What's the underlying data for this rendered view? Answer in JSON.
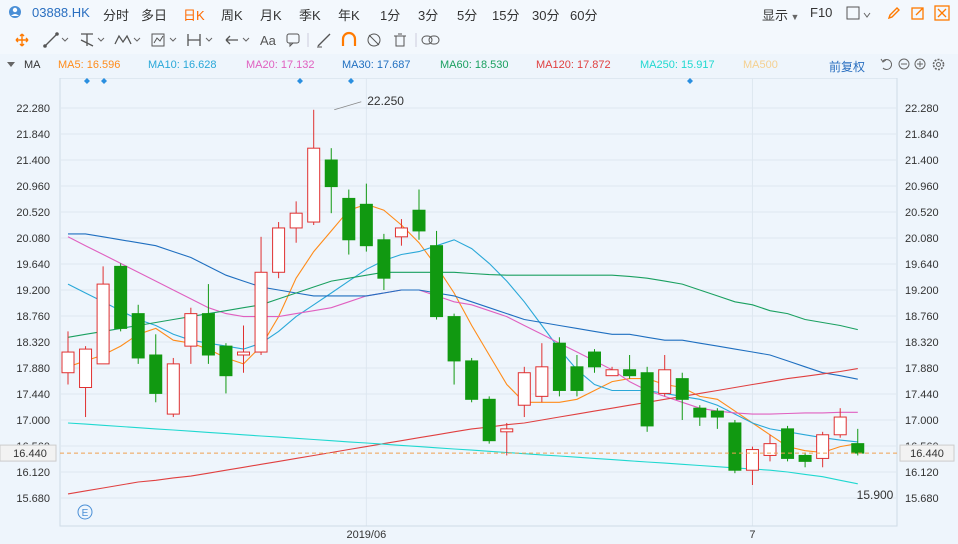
{
  "toolbar": {
    "stock_code": "03888.HK",
    "periods": [
      "分时",
      "多日",
      "日K",
      "周K",
      "月K",
      "季K",
      "年K",
      "1分",
      "3分",
      "5分",
      "15分",
      "30分",
      "60分"
    ],
    "active_period": "日K",
    "display_label": "显示",
    "f10_label": "F10"
  },
  "tools": {
    "text_tool": "Aa",
    "icons": [
      "move-icon",
      "line-icon",
      "channel-icon",
      "wave-icon",
      "measure-icon",
      "range-icon",
      "arrow-icon",
      "text-icon",
      "comment-icon",
      "pen-icon",
      "magnet-icon",
      "hide-icon",
      "trash-icon",
      "link-icon"
    ]
  },
  "indicator_bar": {
    "name": "MA",
    "ma": [
      {
        "label": "MA5: 16.596",
        "color": "#ff8c1a"
      },
      {
        "label": "MA10: 16.628",
        "color": "#2aa8d8"
      },
      {
        "label": "MA20: 17.132",
        "color": "#e060c0"
      },
      {
        "label": "MA30: 17.687",
        "color": "#1f6fc0"
      },
      {
        "label": "MA60: 18.530",
        "color": "#1aa060"
      },
      {
        "label": "MA120: 17.872",
        "color": "#e04040"
      },
      {
        "label": "MA250: 15.917",
        "color": "#20d8d0"
      },
      {
        "label": "MA500",
        "color": "#f5d090"
      }
    ],
    "restore_label": "前复权"
  },
  "colors": {
    "up": "#e03030",
    "down": "#119911",
    "grid": "#dde7f0",
    "axis_text": "#333333"
  },
  "chart_data": {
    "type": "candlestick",
    "y_ticks": [
      22.28,
      21.84,
      21.4,
      20.96,
      20.52,
      20.08,
      19.64,
      19.2,
      18.76,
      18.32,
      17.88,
      17.44,
      17.0,
      16.56,
      16.12,
      15.68
    ],
    "ylim": [
      15.4,
      22.6
    ],
    "x_labels": [
      {
        "index": 17,
        "label": "2019/06"
      },
      {
        "index": 39,
        "label": "7"
      }
    ],
    "current_price": 16.44,
    "annotations": [
      {
        "index": 15,
        "value": 22.25,
        "label": "22.250"
      },
      {
        "index": 43,
        "value": 15.9,
        "label": "15.900"
      }
    ],
    "candles": [
      {
        "o": 17.8,
        "c": 18.15,
        "h": 18.5,
        "l": 17.6
      },
      {
        "o": 17.55,
        "c": 18.2,
        "h": 18.25,
        "l": 17.05
      },
      {
        "o": 17.95,
        "c": 19.3,
        "h": 19.6,
        "l": 17.95
      },
      {
        "o": 19.6,
        "c": 18.55,
        "h": 19.65,
        "l": 18.5
      },
      {
        "o": 18.8,
        "c": 18.05,
        "h": 18.95,
        "l": 17.95
      },
      {
        "o": 18.1,
        "c": 17.45,
        "h": 18.45,
        "l": 17.3
      },
      {
        "o": 17.1,
        "c": 17.95,
        "h": 18.05,
        "l": 17.05
      },
      {
        "o": 18.25,
        "c": 18.8,
        "h": 18.9,
        "l": 17.95
      },
      {
        "o": 18.8,
        "c": 18.1,
        "h": 19.3,
        "l": 17.95
      },
      {
        "o": 18.25,
        "c": 17.75,
        "h": 18.3,
        "l": 17.45
      },
      {
        "o": 18.1,
        "c": 18.15,
        "h": 18.6,
        "l": 17.8
      },
      {
        "o": 18.15,
        "c": 19.5,
        "h": 20.1,
        "l": 18.1
      },
      {
        "o": 19.5,
        "c": 20.25,
        "h": 20.35,
        "l": 19.4
      },
      {
        "o": 20.25,
        "c": 20.5,
        "h": 20.7,
        "l": 20.0
      },
      {
        "o": 20.35,
        "c": 21.6,
        "h": 22.25,
        "l": 20.3
      },
      {
        "o": 21.4,
        "c": 20.95,
        "h": 21.6,
        "l": 20.5
      },
      {
        "o": 20.75,
        "c": 20.05,
        "h": 20.9,
        "l": 19.8
      },
      {
        "o": 20.65,
        "c": 19.95,
        "h": 21.0,
        "l": 19.85
      },
      {
        "o": 20.05,
        "c": 19.4,
        "h": 20.15,
        "l": 19.2
      },
      {
        "o": 20.1,
        "c": 20.25,
        "h": 20.4,
        "l": 19.95
      },
      {
        "o": 20.55,
        "c": 20.2,
        "h": 20.9,
        "l": 20.05
      },
      {
        "o": 19.95,
        "c": 18.75,
        "h": 20.2,
        "l": 18.7
      },
      {
        "o": 18.75,
        "c": 18.0,
        "h": 18.8,
        "l": 17.6
      },
      {
        "o": 18.0,
        "c": 17.35,
        "h": 18.05,
        "l": 17.3
      },
      {
        "o": 17.35,
        "c": 16.65,
        "h": 17.4,
        "l": 16.6
      },
      {
        "o": 16.8,
        "c": 16.85,
        "h": 16.95,
        "l": 16.4
      },
      {
        "o": 17.25,
        "c": 17.8,
        "h": 17.9,
        "l": 17.05
      },
      {
        "o": 17.4,
        "c": 17.9,
        "h": 18.3,
        "l": 17.3
      },
      {
        "o": 18.3,
        "c": 17.5,
        "h": 18.4,
        "l": 17.4
      },
      {
        "o": 17.9,
        "c": 17.5,
        "h": 18.1,
        "l": 17.4
      },
      {
        "o": 18.15,
        "c": 17.9,
        "h": 18.2,
        "l": 17.8
      },
      {
        "o": 17.75,
        "c": 17.85,
        "h": 17.9,
        "l": 17.75
      },
      {
        "o": 17.85,
        "c": 17.75,
        "h": 18.1,
        "l": 17.7
      },
      {
        "o": 17.8,
        "c": 16.9,
        "h": 17.9,
        "l": 16.8
      },
      {
        "o": 17.45,
        "c": 17.85,
        "h": 18.1,
        "l": 17.4
      },
      {
        "o": 17.7,
        "c": 17.35,
        "h": 17.8,
        "l": 17.0
      },
      {
        "o": 17.2,
        "c": 17.05,
        "h": 17.25,
        "l": 16.9
      },
      {
        "o": 17.15,
        "c": 17.05,
        "h": 17.2,
        "l": 16.85
      },
      {
        "o": 16.95,
        "c": 16.15,
        "h": 17.0,
        "l": 16.1
      },
      {
        "o": 16.15,
        "c": 16.5,
        "h": 16.55,
        "l": 15.9
      },
      {
        "o": 16.4,
        "c": 16.6,
        "h": 16.75,
        "l": 16.3
      },
      {
        "o": 16.85,
        "c": 16.35,
        "h": 16.9,
        "l": 16.3
      },
      {
        "o": 16.4,
        "c": 16.3,
        "h": 16.45,
        "l": 16.2
      },
      {
        "o": 16.35,
        "c": 16.75,
        "h": 16.8,
        "l": 16.2
      },
      {
        "o": 16.75,
        "c": 17.05,
        "h": 17.2,
        "l": 16.7
      },
      {
        "o": 16.6,
        "c": 16.44,
        "h": 16.85,
        "l": 16.4
      }
    ],
    "ma_lines": [
      {
        "name": "MA5",
        "color": "#ff8c1a",
        "values": [
          17.9,
          18.0,
          18.1,
          18.25,
          18.45,
          18.55,
          18.35,
          18.3,
          18.2,
          18.05,
          17.95,
          18.25,
          18.75,
          19.4,
          19.85,
          20.2,
          20.55,
          20.65,
          20.55,
          20.3,
          20.0,
          19.6,
          19.15,
          18.6,
          18.1,
          17.6,
          17.3,
          17.3,
          17.3,
          17.35,
          17.5,
          17.65,
          17.7,
          17.7,
          17.6,
          17.55,
          17.4,
          17.35,
          17.15,
          16.95,
          16.75,
          16.55,
          16.48,
          16.45,
          16.55,
          16.6
        ]
      },
      {
        "name": "MA10",
        "color": "#2aa8d8",
        "values": [
          19.3,
          19.15,
          19.0,
          18.85,
          18.7,
          18.6,
          18.45,
          18.35,
          18.3,
          18.25,
          18.2,
          18.3,
          18.5,
          18.75,
          18.95,
          19.15,
          19.35,
          19.55,
          19.7,
          19.8,
          19.85,
          19.95,
          20.05,
          19.9,
          19.65,
          19.35,
          19.0,
          18.6,
          18.2,
          17.85,
          17.6,
          17.5,
          17.5,
          17.5,
          17.45,
          17.4,
          17.35,
          17.25,
          17.1,
          16.95,
          16.85,
          16.8,
          16.75,
          16.7,
          16.66,
          16.63
        ]
      },
      {
        "name": "MA20",
        "color": "#e060c0",
        "values": [
          20.1,
          19.95,
          19.8,
          19.65,
          19.5,
          19.35,
          19.2,
          19.05,
          18.9,
          18.8,
          18.75,
          18.75,
          18.75,
          18.8,
          18.85,
          18.9,
          19.0,
          19.1,
          19.15,
          19.2,
          19.2,
          19.1,
          19.0,
          18.95,
          18.85,
          18.75,
          18.6,
          18.45,
          18.3,
          18.15,
          18.0,
          17.85,
          17.65,
          17.5,
          17.4,
          17.3,
          17.2,
          17.15,
          17.12,
          17.1,
          17.1,
          17.11,
          17.12,
          17.12,
          17.13,
          17.13
        ]
      },
      {
        "name": "MA30",
        "color": "#1f6fc0",
        "values": [
          20.15,
          20.15,
          20.1,
          20.05,
          20.0,
          19.95,
          19.85,
          19.75,
          19.6,
          19.45,
          19.35,
          19.25,
          19.2,
          19.15,
          19.1,
          19.1,
          19.1,
          19.1,
          19.15,
          19.2,
          19.2,
          19.15,
          19.1,
          19.0,
          18.9,
          18.8,
          18.7,
          18.65,
          18.6,
          18.55,
          18.5,
          18.45,
          18.45,
          18.4,
          18.35,
          18.35,
          18.3,
          18.25,
          18.2,
          18.15,
          18.1,
          18.0,
          17.9,
          17.8,
          17.75,
          17.69
        ]
      },
      {
        "name": "MA60",
        "color": "#1aa060",
        "values": [
          18.4,
          18.45,
          18.5,
          18.55,
          18.6,
          18.65,
          18.7,
          18.75,
          18.8,
          18.85,
          18.9,
          18.95,
          19.05,
          19.15,
          19.25,
          19.35,
          19.4,
          19.45,
          19.5,
          19.5,
          19.5,
          19.5,
          19.5,
          19.48,
          19.46,
          19.45,
          19.45,
          19.45,
          19.45,
          19.45,
          19.45,
          19.45,
          19.43,
          19.4,
          19.35,
          19.3,
          19.2,
          19.1,
          19.0,
          18.95,
          18.85,
          18.8,
          18.7,
          18.65,
          18.6,
          18.53
        ]
      },
      {
        "name": "MA120",
        "color": "#e04040",
        "values": [
          15.75,
          15.8,
          15.85,
          15.9,
          15.95,
          15.98,
          16.02,
          16.05,
          16.1,
          16.15,
          16.2,
          16.25,
          16.3,
          16.35,
          16.4,
          16.45,
          16.5,
          16.55,
          16.6,
          16.65,
          16.7,
          16.75,
          16.8,
          16.85,
          16.88,
          16.92,
          16.95,
          17.0,
          17.05,
          17.1,
          17.15,
          17.2,
          17.25,
          17.3,
          17.35,
          17.4,
          17.45,
          17.5,
          17.55,
          17.6,
          17.65,
          17.7,
          17.74,
          17.78,
          17.82,
          17.87
        ]
      },
      {
        "name": "MA250",
        "color": "#20d8d0",
        "values": [
          16.95,
          16.93,
          16.91,
          16.89,
          16.87,
          16.85,
          16.83,
          16.81,
          16.79,
          16.77,
          16.75,
          16.73,
          16.71,
          16.69,
          16.67,
          16.65,
          16.63,
          16.61,
          16.59,
          16.57,
          16.55,
          16.53,
          16.51,
          16.49,
          16.47,
          16.45,
          16.43,
          16.41,
          16.39,
          16.37,
          16.35,
          16.33,
          16.31,
          16.29,
          16.27,
          16.25,
          16.23,
          16.21,
          16.19,
          16.17,
          16.15,
          16.12,
          16.08,
          16.04,
          15.98,
          15.92
        ]
      }
    ]
  }
}
